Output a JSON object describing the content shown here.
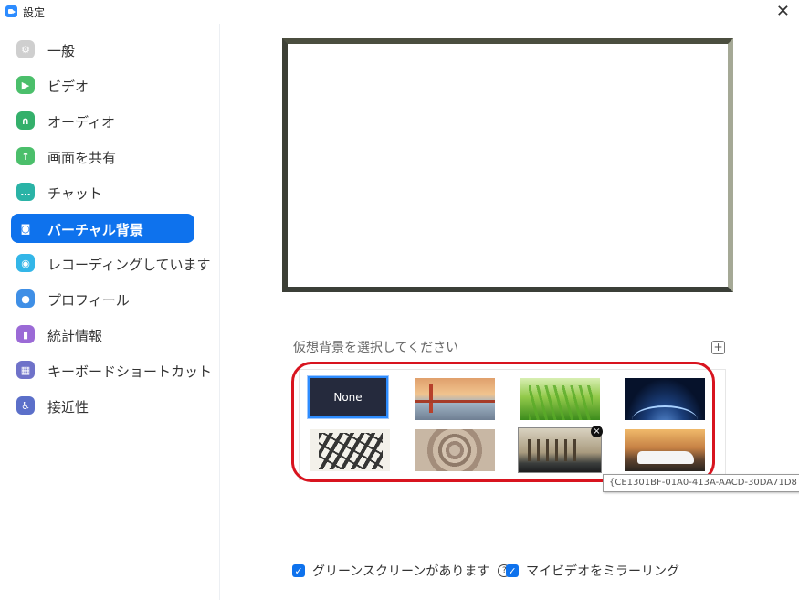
{
  "window": {
    "title": "設定"
  },
  "sidebar": {
    "items": [
      {
        "label": "一般",
        "icon": "gear-icon",
        "color": "#c7c7c7",
        "glyph": "⚙"
      },
      {
        "label": "ビデオ",
        "icon": "video-icon",
        "color": "#4bbf6b",
        "glyph": "▶"
      },
      {
        "label": "オーディオ",
        "icon": "headphones-icon",
        "color": "#34b06b",
        "glyph": "∩"
      },
      {
        "label": "画面を共有",
        "icon": "share-screen-icon",
        "color": "#4bbf6b",
        "glyph": "↑"
      },
      {
        "label": "チャット",
        "icon": "chat-icon",
        "color": "#2ab3a6",
        "glyph": "…"
      },
      {
        "label": "バーチャル背景",
        "icon": "virtual-background-icon",
        "color": "#0e72ed",
        "glyph": "◙",
        "active": true
      },
      {
        "label": "レコーディングしています",
        "icon": "record-icon",
        "color": "#33b6e8",
        "glyph": "◉"
      },
      {
        "label": "プロフィール",
        "icon": "profile-icon",
        "color": "#3f8fe6",
        "glyph": "●"
      },
      {
        "label": "統計情報",
        "icon": "statistics-icon",
        "color": "#9b6ad6",
        "glyph": "▮"
      },
      {
        "label": "キーボードショートカット",
        "icon": "keyboard-icon",
        "color": "#6f72c9",
        "glyph": "▦"
      },
      {
        "label": "接近性",
        "icon": "accessibility-icon",
        "color": "#5b6fc9",
        "glyph": "♿"
      }
    ]
  },
  "main": {
    "section_title": "仮想背景を選択してください",
    "add_glyph": "+",
    "backgrounds": [
      {
        "label": "None",
        "name": "bg-none"
      },
      {
        "label": "",
        "name": "bg-golden-gate-bridge"
      },
      {
        "label": "",
        "name": "bg-grass"
      },
      {
        "label": "",
        "name": "bg-earth-from-space"
      },
      {
        "label": "",
        "name": "bg-ink-art"
      },
      {
        "label": "",
        "name": "bg-mandala"
      },
      {
        "label": "",
        "name": "bg-house"
      },
      {
        "label": "",
        "name": "bg-limousine"
      }
    ],
    "thumb_close_glyph": "×",
    "tooltip": "{CE1301BF-01A0-413A-AACD-30DA71D8",
    "options": [
      {
        "label": "グリーンスクリーンがあります",
        "checked": true
      },
      {
        "label": "マイビデオをミラーリング",
        "checked": true
      }
    ],
    "help_glyph": "?",
    "check_glyph": "✓"
  },
  "colors": {
    "accent": "#0e72ed",
    "highlight_outline": "#d8141f"
  }
}
